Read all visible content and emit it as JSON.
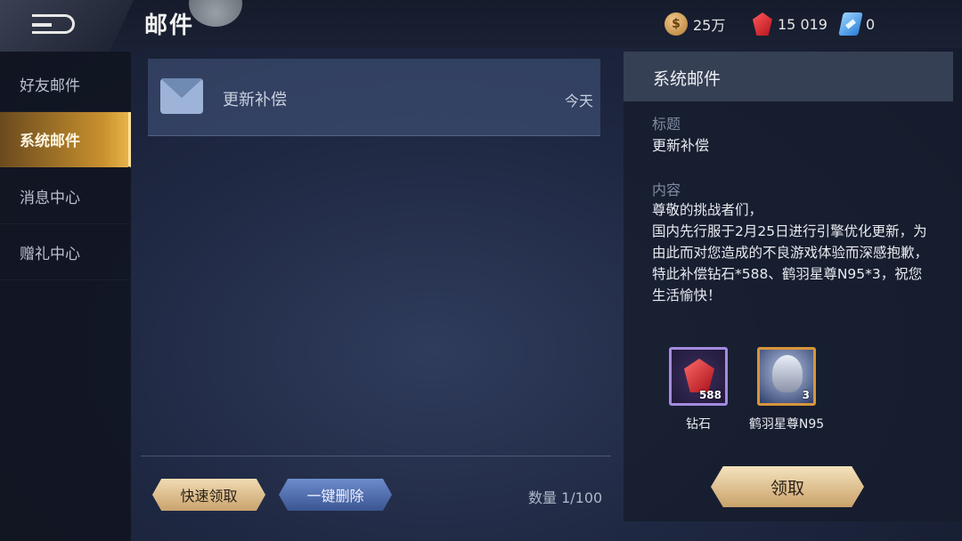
{
  "header": {
    "title": "邮件"
  },
  "currencies": [
    {
      "icon": "gold-coin-icon",
      "symbol": "$",
      "value": "25万"
    },
    {
      "icon": "red-diamond-icon",
      "value": "15 019"
    },
    {
      "icon": "blue-voucher-icon",
      "value": "0"
    }
  ],
  "sidebar": {
    "items": [
      {
        "label": "好友邮件",
        "active": false
      },
      {
        "label": "系统邮件",
        "active": true
      },
      {
        "label": "消息中心",
        "active": false
      },
      {
        "label": "赠礼中心",
        "active": false
      }
    ]
  },
  "mail_list": {
    "items": [
      {
        "icon": "envelope-icon",
        "title": "更新补偿",
        "date": "今天"
      }
    ],
    "quick_claim_label": "快速领取",
    "delete_all_label": "一键删除",
    "count_text": "数量 1/100"
  },
  "detail": {
    "header": "系统邮件",
    "subject_label": "标题",
    "subject": "更新补偿",
    "content_label": "内容",
    "content": "尊敬的挑战者们，\n国内先行服于2月25日进行引擎优化更新，为由此而对您造成的不良游戏体验而深感抱歉，特此补偿钻石*588、鹤羽星尊N95*3，祝您生活愉快！",
    "rewards": [
      {
        "icon": "diamond-icon",
        "name": "钻石",
        "count": "588"
      },
      {
        "icon": "hero-avatar-icon",
        "name": "鹤羽星尊N95",
        "count": "3"
      }
    ],
    "claim_label": "领取"
  },
  "colors": {
    "accent_gold": "#c8902e",
    "gem_red": "#d4141f",
    "panel": "#1f2842"
  }
}
